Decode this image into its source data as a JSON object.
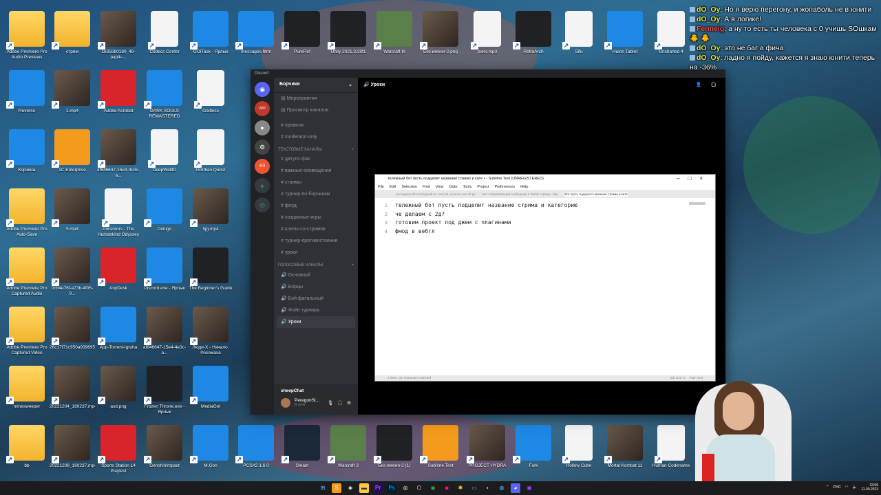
{
  "desktop_icons": [
    {
      "label": "Adobe Premiere Pro Audio Previews",
      "kind": "folder"
    },
    {
      "label": "стрим",
      "kind": "folder"
    },
    {
      "label": "1635880180_49-papik-...",
      "kind": "photo"
    },
    {
      "label": "Codecs Center",
      "kind": "doc"
    },
    {
      "label": "GOITask - Ярлык",
      "kind": "blue"
    },
    {
      "label": "messages.html",
      "kind": "blue"
    },
    {
      "label": "PureRef",
      "kind": "dark"
    },
    {
      "label": "Unity 2021.3.28f1",
      "kind": "dark"
    },
    {
      "label": "Warcraft III",
      "kind": "green"
    },
    {
      "label": "Без имени-2.png",
      "kind": "photo"
    },
    {
      "label": "pwer.mp3",
      "kind": "doc"
    },
    {
      "label": "RetroArch",
      "kind": "dark"
    },
    {
      "label": "Sifu",
      "kind": "doc"
    },
    {
      "label": "Huion Tablet",
      "kind": "blue"
    },
    {
      "label": "Uncharted 4",
      "kind": "doc"
    },
    {
      "label": "Reverso",
      "kind": "blue"
    },
    {
      "label": "1.mp4",
      "kind": "photo"
    },
    {
      "label": "Adobe Acrobat",
      "kind": "red"
    },
    {
      "label": "DARK SOULS REMASTERED",
      "kind": "blue"
    },
    {
      "label": "Godless",
      "kind": "doc"
    },
    {
      "label": "Корзина",
      "kind": "blue"
    },
    {
      "label": "1C Enterprise",
      "kind": "orange"
    },
    {
      "label": "af846647-15e4-4e3c-a...",
      "kind": "photo"
    },
    {
      "label": "DeepWellID",
      "kind": "doc"
    },
    {
      "label": "Gordian Quest",
      "kind": "doc"
    },
    {
      "label": "Adobe Premiere Pro Auto-Save",
      "kind": "folder"
    },
    {
      "label": "5.mp4",
      "kind": "photo"
    },
    {
      "label": "Ancestors - The Humankind Odyssey",
      "kind": "doc"
    },
    {
      "label": "Deluge",
      "kind": "blue"
    },
    {
      "label": "hjg.mp4",
      "kind": "photo"
    },
    {
      "label": "Adobe Premiere Pro Captured Audio",
      "kind": "folder"
    },
    {
      "label": "0cb4e76f-a73b-4f06-9...",
      "kind": "photo"
    },
    {
      "label": "AnyDesk",
      "kind": "red"
    },
    {
      "label": "Discord.exe - Ярлык",
      "kind": "blue"
    },
    {
      "label": "The Beginner's Guide",
      "kind": "dark"
    },
    {
      "label": "Adobe Premiere Pro Captured Video",
      "kind": "folder"
    },
    {
      "label": "26c17f71c950a9396958...",
      "kind": "photo"
    },
    {
      "label": "App-Torrent-Igruha",
      "kind": "blue"
    },
    {
      "label": "af846647-15e4-4e3c-a...",
      "kind": "photo"
    },
    {
      "label": "Люди-Х - Начало. Росомаха",
      "kind": "photo"
    },
    {
      "label": "minesweeper",
      "kind": "folder"
    },
    {
      "label": "20221204_160237.mp4",
      "kind": "photo"
    },
    {
      "label": "asd.png",
      "kind": "photo"
    },
    {
      "label": "Frozen Throne.exe - Ярлык",
      "kind": "dark"
    },
    {
      "label": "MediaGet",
      "kind": "blue"
    }
  ],
  "bottom_row_icons": [
    {
      "label": "bb",
      "kind": "folder"
    },
    {
      "label": "20221208_160237.mp4",
      "kind": "photo"
    },
    {
      "label": "Sports Station 14 Playtest",
      "kind": "red"
    },
    {
      "label": "GenshinImpact",
      "kind": "photo"
    },
    {
      "label": "M.Gon",
      "kind": "blue"
    },
    {
      "label": "PCSX2 1.6.0",
      "kind": "blue"
    },
    {
      "label": "Steam",
      "kind": "steam"
    },
    {
      "label": "Warcraft 3",
      "kind": "green"
    },
    {
      "label": "Без имени-2 (1)",
      "kind": "dark"
    },
    {
      "label": "Sublime Text",
      "kind": "orange"
    },
    {
      "label": "PROJECT HYDRA",
      "kind": "photo"
    },
    {
      "label": "Fork",
      "kind": "blue"
    },
    {
      "label": "Hollow Cube",
      "kind": "doc"
    },
    {
      "label": "Mortal Kombat 11",
      "kind": "photo"
    },
    {
      "label": "Human Codename",
      "kind": "doc"
    }
  ],
  "discord": {
    "app_title": "Discord",
    "server_name": "Борчики",
    "current_channel": "Уроки",
    "top_items": [
      "Мероприятия",
      "Просмотр каналов"
    ],
    "pinned_channels": [
      "правила",
      "moderator-only"
    ],
    "text_category": "ТЕКСТОВЫЕ КАНАЛЫ",
    "text_channels": [
      "датупс-фас",
      "важные-оповещения",
      "стримы",
      "турнир-по-борчикам",
      "флуд",
      "созданные-игры",
      "клипы-со-стримов",
      "турнир-противостояние",
      "уроки"
    ],
    "voice_category": "ГОЛОСОВЫЕ КАНАЛЫ",
    "voice_channels": [
      "Основной",
      "Борцы",
      "Бой фатальный",
      "Фойе турнира",
      "Уроки"
    ],
    "sheep_label": "sheepChat",
    "user_name": "PeregonSt...",
    "user_status": "В сети"
  },
  "sublime": {
    "title": "тележный бот пусть подцепит название стримо и кате • - Sublime Text (UNREGISTERED)",
    "menu": [
      "File",
      "Edit",
      "Selection",
      "Find",
      "View",
      "Goto",
      "Tools",
      "Project",
      "Preferences",
      "Help"
    ],
    "tabs": [
      "последние 20 сообщений по чату 50, в после нее 20 ра",
      "Бот отправляющий сообщения в Twitch стримы. Нау",
      "бот пусть подцепит название стрима и кате"
    ],
    "lines": [
      {
        "n": "1",
        "text": "тележный бот пусть подцепит название стрима и категорию"
      },
      {
        "n": "2",
        "text": "че делаем с 2д?"
      },
      {
        "n": "3",
        "text": "готовим проект под джем с плагинами"
      },
      {
        "n": "4",
        "text": "фмод в вебгл"
      }
    ],
    "status_left": "4 lines, 118 characters selected",
    "status_tab": "Tab Size: 4",
    "status_syntax": "Plain Text"
  },
  "chat": [
    {
      "user": "dO_Oy",
      "color": "#d8e84a",
      "text": "Но я верю перегону, и жопаболь не в юнити"
    },
    {
      "user": "dO_Oy",
      "color": "#d8e84a",
      "text": "А в логике!"
    },
    {
      "user": "Fenneig",
      "color": "#ff4d4d",
      "text": "а ну то есть ты человека с 0 учишь SОшкам 🐥 🐥"
    },
    {
      "user": "dO_Oy",
      "color": "#d8e84a",
      "text": "это не баг а фича"
    },
    {
      "user": "dO_Oy",
      "color": "#d8e84a",
      "text": "ладно я пойду, кажется я знаю юнити теперь на -36%"
    }
  ],
  "taskbar": {
    "lang": "РУС",
    "time": "23:59",
    "date": "11.09.2023"
  }
}
